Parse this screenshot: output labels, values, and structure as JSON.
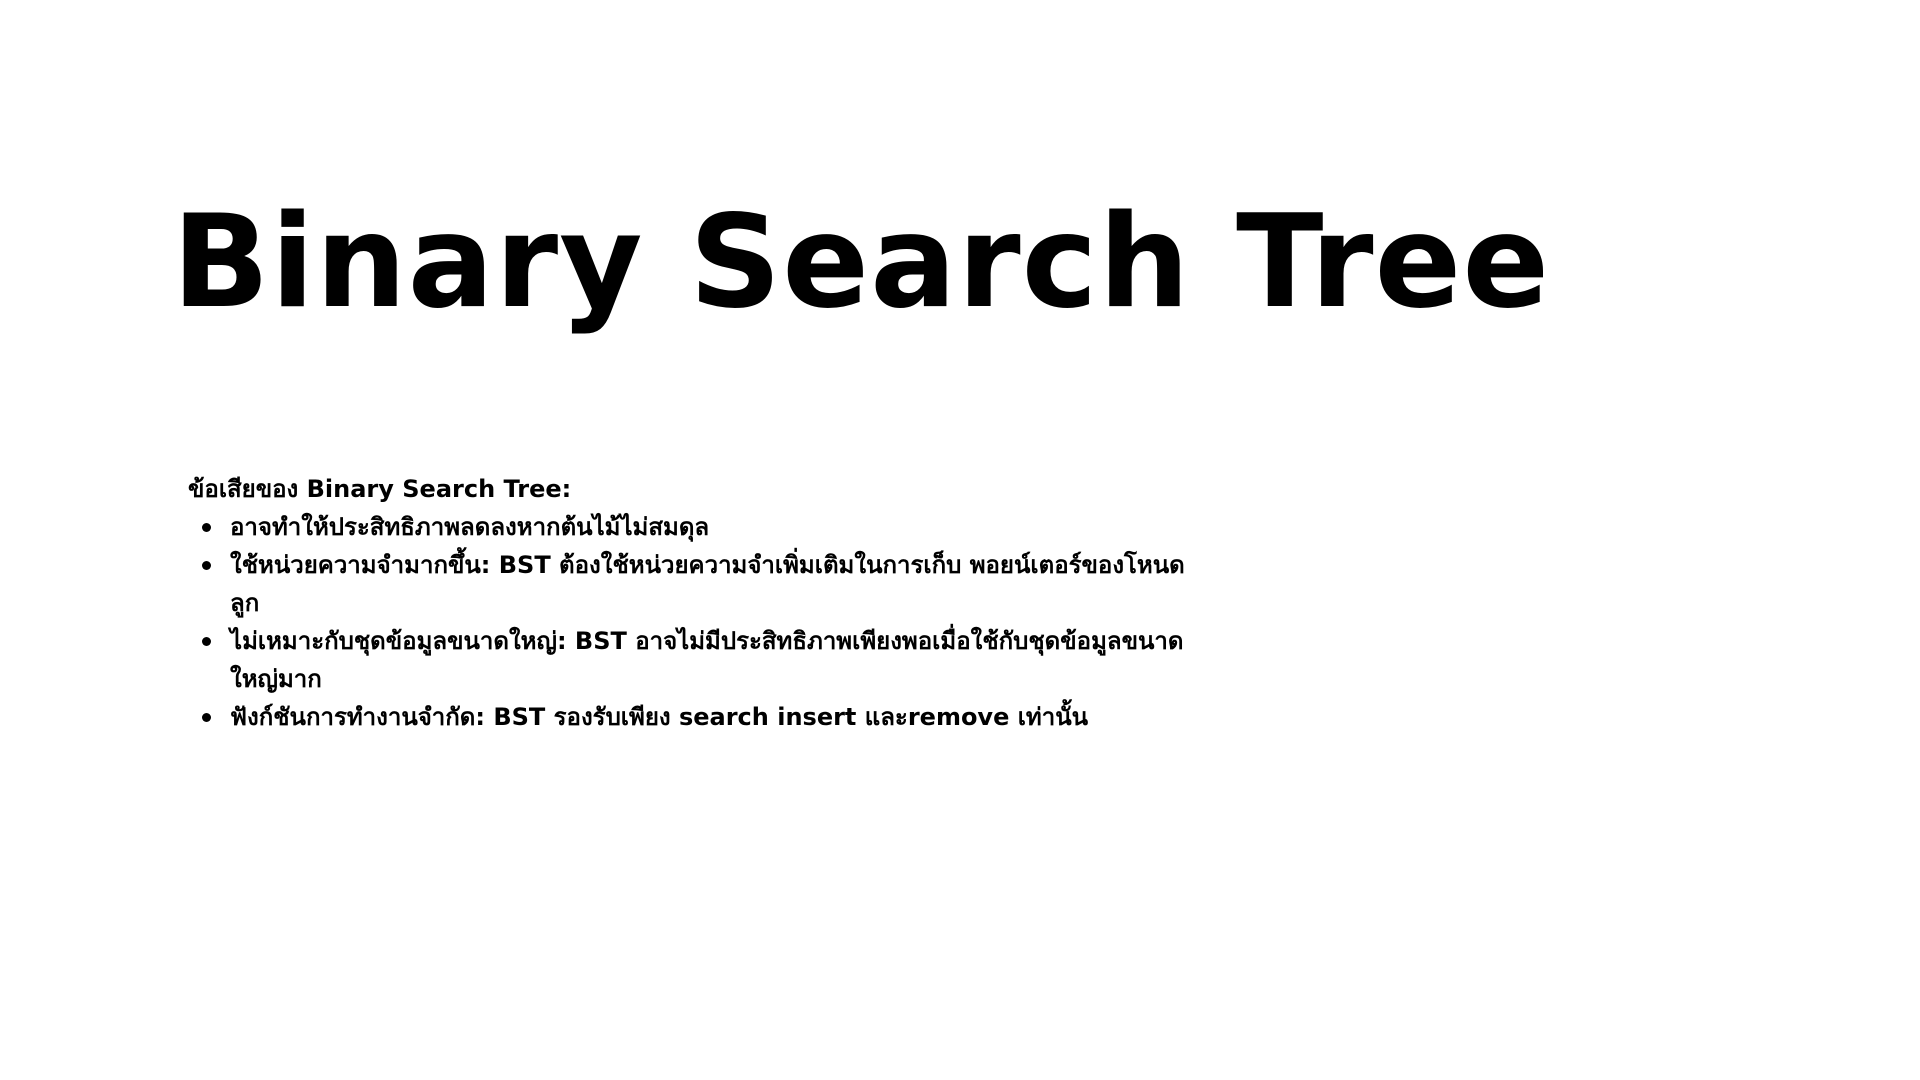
{
  "slide": {
    "title": "Binary Search Tree",
    "intro": "ข้อเสียของ Binary Search Tree:",
    "bullets": [
      {
        "text": "อาจทำให้ประสิทธิภาพลดลงหากต้นไม้ไม่สมดุล"
      },
      {
        "text": "ใช้หน่วยความจำมากขึ้น: BST ต้องใช้หน่วยความจำเพิ่มเติมในการเก็บ พอยน์เตอร์ของโหนดลูก"
      },
      {
        "text": "ไม่เหมาะกับชุดข้อมูลขนาดใหญ่: BST อาจไม่มีประสิทธิภาพเพียงพอเมื่อใช้กับชุดข้อมูลขนาดใหญ่มาก"
      },
      {
        "text": "ฟังก์ชันการทำงานจำกัด: BST รองรับเพียง search insert และremove เท่านั้น"
      }
    ]
  }
}
